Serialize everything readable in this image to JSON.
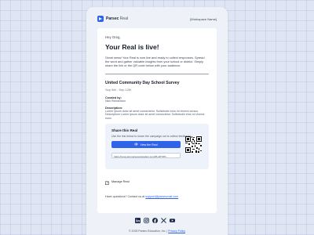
{
  "brand": {
    "name_bold": "Parsec",
    "name_light": "Real",
    "workspace": "[Workspace Name]"
  },
  "email": {
    "greeting": "Hey Greg,",
    "headline": "Your Real is live!",
    "intro": "Great news! Your Real is now live and ready to collect responses. Spread the word and gather valuable insights from your school or district. Simply share the link or the QR code below with your audience."
  },
  "survey": {
    "title": "United Community Day School Survey",
    "dates": "Sep 8th - Sep 12th",
    "created_by_label": "Created by:",
    "created_by_value": "Nick Richardson",
    "description_label": "Description:",
    "description_value": "Lorem ipsum dolor sit amet consectetur. Sollicitudin eros mi viverra cursus. Descriptiom Lorem ipsum dolor sit amet consectetur. Sollicitudin eros mi viverra nunc."
  },
  "share": {
    "title": "Share this Real",
    "subtitle": "Use the link below to share the campaign out to collect feedback!",
    "button_label": "View the Real",
    "link": "https://reca.app.parseceducation.com/PL1PYPH..."
  },
  "manage": {
    "label": "Manage Real"
  },
  "help": {
    "prefix": "Have questions? Contact us at",
    "email": "support@parsecmail.com"
  },
  "social": [
    "linkedin-icon",
    "instagram-icon",
    "facebook-icon",
    "x-icon",
    "youtube-icon"
  ],
  "footer": {
    "copyright": "© 2025 Parsec Education, Inc. |",
    "privacy": "Privacy Policy"
  },
  "colors": {
    "accent": "#2f63e8",
    "background": "#dfe5f3",
    "card": "#ffffff"
  }
}
